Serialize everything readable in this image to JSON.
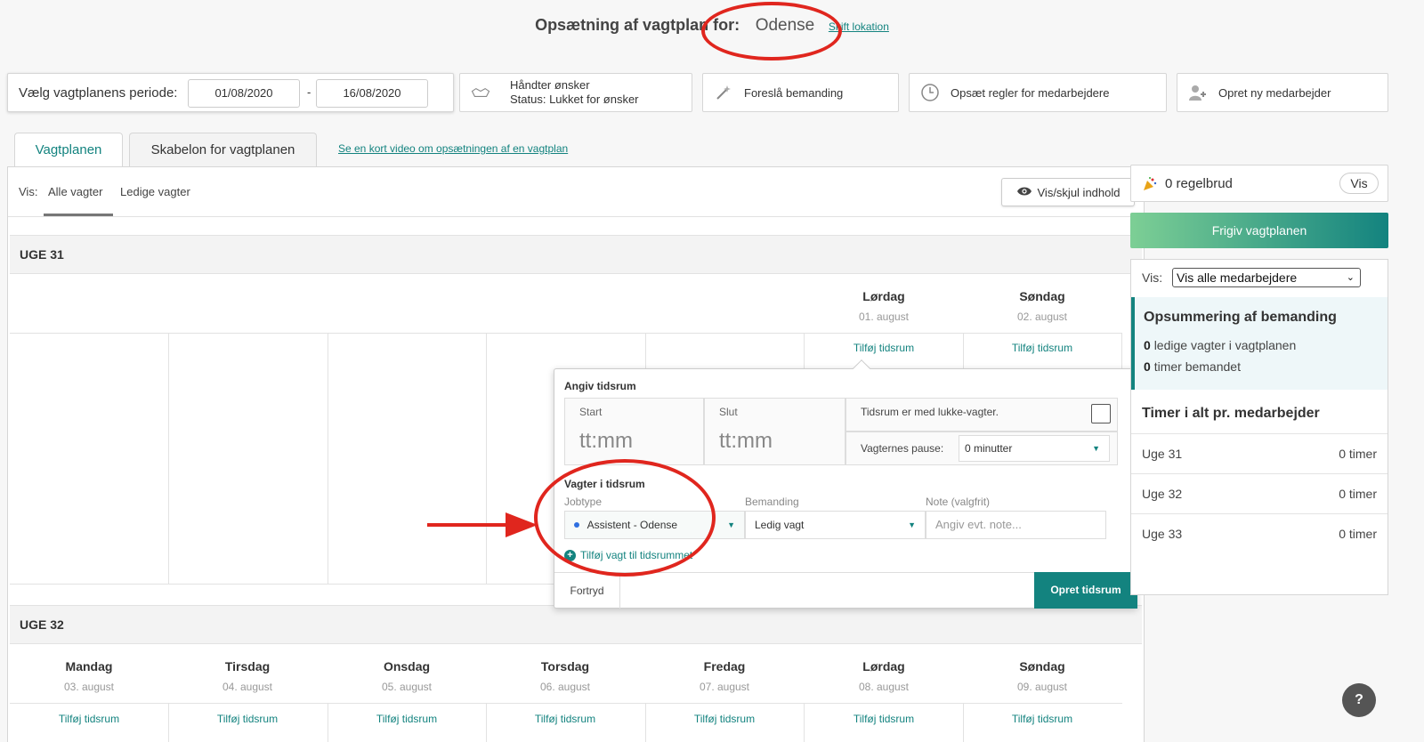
{
  "header": {
    "label": "Opsætning af vagtplan for:",
    "location": "Odense",
    "change_location": "Skift lokation"
  },
  "period": {
    "label": "Vælg vagtplanens periode:",
    "from": "01/08/2020",
    "separator": "-",
    "to": "16/08/2020"
  },
  "toolbar": {
    "wishes_title": "Håndter ønsker",
    "wishes_status": "Status: Lukket for ønsker",
    "suggest_staffing": "Foreslå bemanding",
    "rules": "Opsæt regler for medarbejdere",
    "new_employee": "Opret ny medarbejder"
  },
  "tabs": {
    "schedule": "Vagtplanen",
    "template": "Skabelon for vagtplanen",
    "video_link": "Se en kort video om opsætningen af en vagtplan"
  },
  "view": {
    "label": "Vis:",
    "all_shifts": "Alle vagter",
    "free_shifts": "Ledige vagter",
    "toggle_content": "Vis/skjul indhold"
  },
  "weeks": [
    {
      "title": "UGE 31",
      "days": [
        {
          "name": "Lørdag",
          "date": "01. august"
        },
        {
          "name": "Søndag",
          "date": "02. august"
        }
      ]
    },
    {
      "title": "UGE 32",
      "days": [
        {
          "name": "Mandag",
          "date": "03. august"
        },
        {
          "name": "Tirsdag",
          "date": "04. august"
        },
        {
          "name": "Onsdag",
          "date": "05. august"
        },
        {
          "name": "Torsdag",
          "date": "06. august"
        },
        {
          "name": "Fredag",
          "date": "07. august"
        },
        {
          "name": "Lørdag",
          "date": "08. august"
        },
        {
          "name": "Søndag",
          "date": "09. august"
        }
      ]
    }
  ],
  "add_slot": "Tilføj tidsrum",
  "popup": {
    "title": "Angiv tidsrum",
    "start_label": "Start",
    "start_placeholder": "tt:mm",
    "end_label": "Slut",
    "end_placeholder": "tt:mm",
    "closing_label": "Tidsrum er med lukke-vagter.",
    "break_label": "Vagternes pause:",
    "break_value": "0 minutter",
    "shifts_title": "Vagter i tidsrum",
    "jobtype_label": "Jobtype",
    "jobtype_value": "Assistent - Odense",
    "staffing_label": "Bemanding",
    "staffing_value": "Ledig vagt",
    "note_label": "Note (valgfrit)",
    "note_placeholder": "Angiv evt. note...",
    "add_shift": "Tilføj vagt til tidsrummet",
    "cancel": "Fortryd",
    "create": "Opret tidsrum"
  },
  "sidebar": {
    "rule_breaks": "0 regelbrud",
    "rule_breaks_btn": "Vis",
    "release": "Frigiv vagtplanen",
    "view_label": "Vis:",
    "view_select": "Vis alle medarbejdere",
    "summary_title": "Opsummering af bemanding",
    "free_count": "0",
    "free_text": "ledige vagter i vagtplanen",
    "hours_count": "0",
    "hours_text": "timer bemandet",
    "hours_title": "Timer i alt pr. medarbejder",
    "week_hours": [
      {
        "week": "Uge 31",
        "hours": "0 timer"
      },
      {
        "week": "Uge 32",
        "hours": "0 timer"
      },
      {
        "week": "Uge 33",
        "hours": "0 timer"
      }
    ]
  },
  "help": "?",
  "colors": {
    "accent": "#13837f",
    "annotation": "#e0261e"
  }
}
